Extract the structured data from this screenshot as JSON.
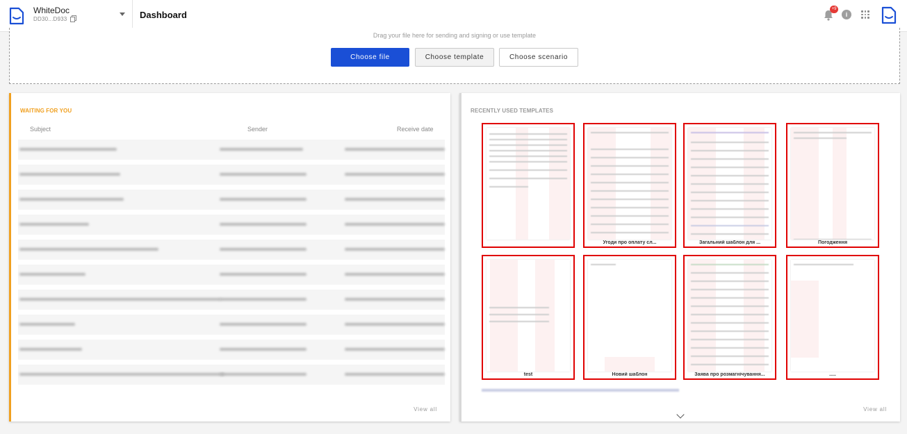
{
  "org": {
    "name": "WhiteDoc",
    "id": "DD30...D933"
  },
  "header": {
    "title": "Dashboard",
    "notifications_badge": "+9",
    "info_glyph": "i"
  },
  "upload": {
    "hint": "Drag your file here for sending and signing or use template",
    "choose_file": "Choose file",
    "choose_template": "Choose template",
    "choose_scenario": "Choose scenario"
  },
  "waiting": {
    "title": "WAITING FOR YOU",
    "columns": {
      "subject": "Subject",
      "sender": "Sender",
      "date": "Receive date"
    },
    "view_all": "View all",
    "row_count": 10
  },
  "templates": {
    "title": "RECENTLY USED TEMPLATES",
    "view_all": "View all",
    "items": [
      {
        "name": ""
      },
      {
        "name": "Угоди про оплату сл..."
      },
      {
        "name": "Загальний шаблон для ..."
      },
      {
        "name": "Погодження"
      },
      {
        "name": "test"
      },
      {
        "name": "Новий шаблон"
      },
      {
        "name": "Заява про розмагнічування..."
      },
      {
        "name": "....."
      }
    ]
  },
  "colors": {
    "accent": "#1a4fd6",
    "waiting_accent": "#f0a020",
    "highlight": "#e00000",
    "badge": "#e53935"
  }
}
